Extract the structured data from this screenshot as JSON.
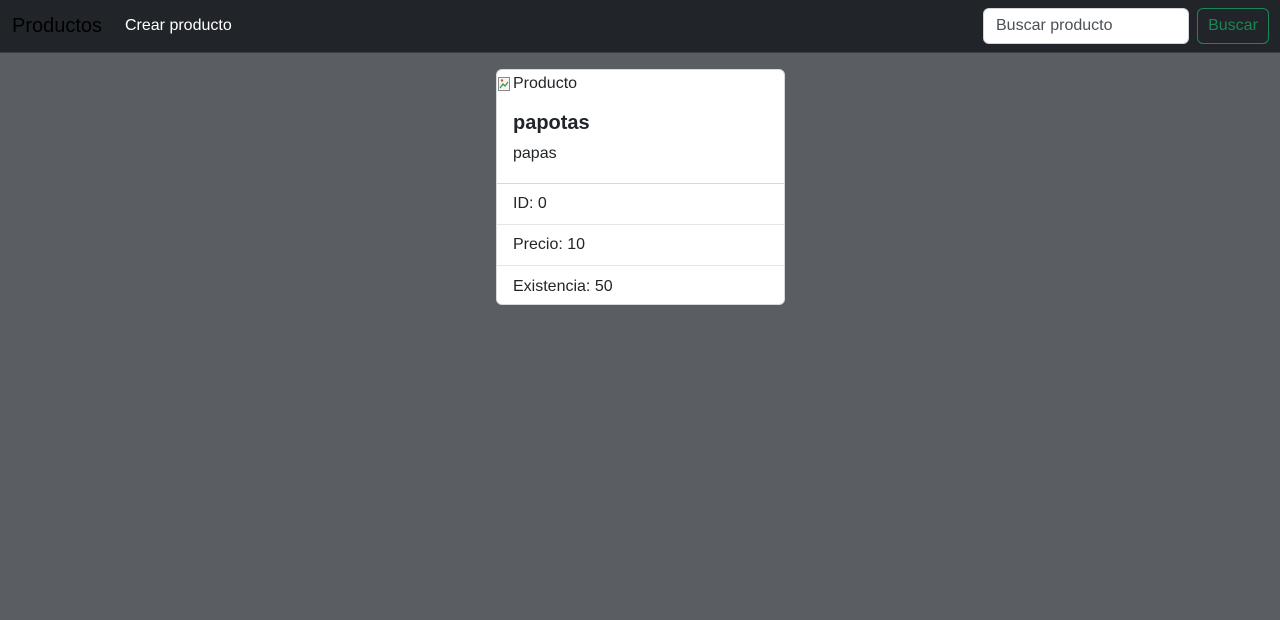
{
  "navbar": {
    "brand": "Productos",
    "create_link": "Crear producto",
    "search_placeholder": "Buscar producto",
    "search_button": "Buscar"
  },
  "product": {
    "image_alt": "Producto",
    "name": "papotas",
    "description": "papas",
    "details": [
      {
        "label": "ID:",
        "value": "0"
      },
      {
        "label": "Precio:",
        "value": "10"
      },
      {
        "label": "Existencia:",
        "value": "50"
      }
    ]
  },
  "icons": {
    "broken_image": "broken-image-icon"
  },
  "colors": {
    "navbar_bg": "#212529",
    "page_bg": "#5a5e62",
    "success": "#198754"
  }
}
